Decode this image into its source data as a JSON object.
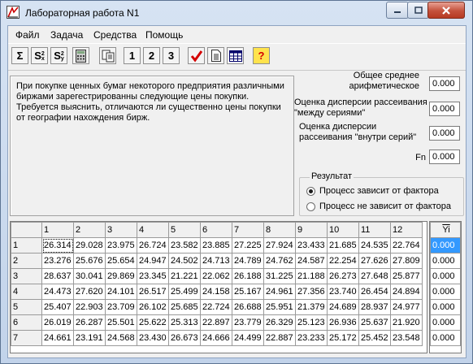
{
  "window": {
    "title": "Лабораторная работа N1"
  },
  "menu": [
    "Файл",
    "Задача",
    "Средства",
    "Помощь"
  ],
  "toolbar": {
    "sigma": "Σ",
    "s2x": "S",
    "s2y": "S",
    "sup": "2",
    "sub_x": "x",
    "sub_y": "y",
    "one": "1",
    "two": "2",
    "three": "3",
    "help": "?"
  },
  "task_text": "При покупке ценных бумаг некоторого предприятия различными биржами зарегестрированны следующие цены покупки. Требуется выяснить, отличаются ли существенно цены покупки от географии нахождения бирж.",
  "stats": {
    "mean_label": "Общее среднее арифметическое",
    "mean_value": "0.000",
    "between_label": "Оценка дисперсии рассеивания \"между сериями\"",
    "between_value": "0.000",
    "within_label": "Оценка дисперсии рассеивания \"внутри серий\"",
    "within_value": "0.000",
    "fn_label": "Fn",
    "fn_value": "0.000"
  },
  "result": {
    "title": "Результат",
    "option1": "Процесс зависит от фактора",
    "option2": "Процесс не зависит от фактора",
    "selected": 1
  },
  "table": {
    "columns": [
      "1",
      "2",
      "3",
      "4",
      "5",
      "6",
      "7",
      "8",
      "9",
      "10",
      "11",
      "12"
    ],
    "rows": [
      {
        "h": "1",
        "v": [
          "26.314",
          "29.028",
          "23.975",
          "26.724",
          "23.582",
          "23.885",
          "27.225",
          "27.924",
          "23.433",
          "21.685",
          "24.535",
          "22.764"
        ]
      },
      {
        "h": "2",
        "v": [
          "23.276",
          "25.676",
          "25.654",
          "24.947",
          "24.502",
          "24.713",
          "24.789",
          "24.762",
          "24.587",
          "22.254",
          "27.626",
          "27.809"
        ]
      },
      {
        "h": "3",
        "v": [
          "28.637",
          "30.041",
          "29.869",
          "23.345",
          "21.221",
          "22.062",
          "26.188",
          "31.225",
          "21.188",
          "26.273",
          "27.648",
          "25.877"
        ]
      },
      {
        "h": "4",
        "v": [
          "24.473",
          "27.620",
          "24.101",
          "26.517",
          "25.499",
          "24.158",
          "25.167",
          "24.961",
          "27.356",
          "23.740",
          "26.454",
          "24.894"
        ]
      },
      {
        "h": "5",
        "v": [
          "25.407",
          "22.903",
          "23.709",
          "26.102",
          "25.685",
          "22.724",
          "26.688",
          "25.951",
          "21.379",
          "24.689",
          "28.937",
          "24.977"
        ]
      },
      {
        "h": "6",
        "v": [
          "26.019",
          "26.287",
          "25.501",
          "25.622",
          "25.313",
          "22.897",
          "23.779",
          "26.329",
          "25.123",
          "26.936",
          "25.637",
          "21.920"
        ]
      },
      {
        "h": "7",
        "v": [
          "24.661",
          "23.191",
          "24.568",
          "23.430",
          "26.673",
          "24.666",
          "24.499",
          "22.887",
          "23.233",
          "25.172",
          "25.452",
          "23.548"
        ]
      }
    ]
  },
  "yi": {
    "header": "Yi",
    "values": [
      "0.000",
      "0.000",
      "0.000",
      "0.000",
      "0.000",
      "0.000",
      "0.000"
    ]
  }
}
